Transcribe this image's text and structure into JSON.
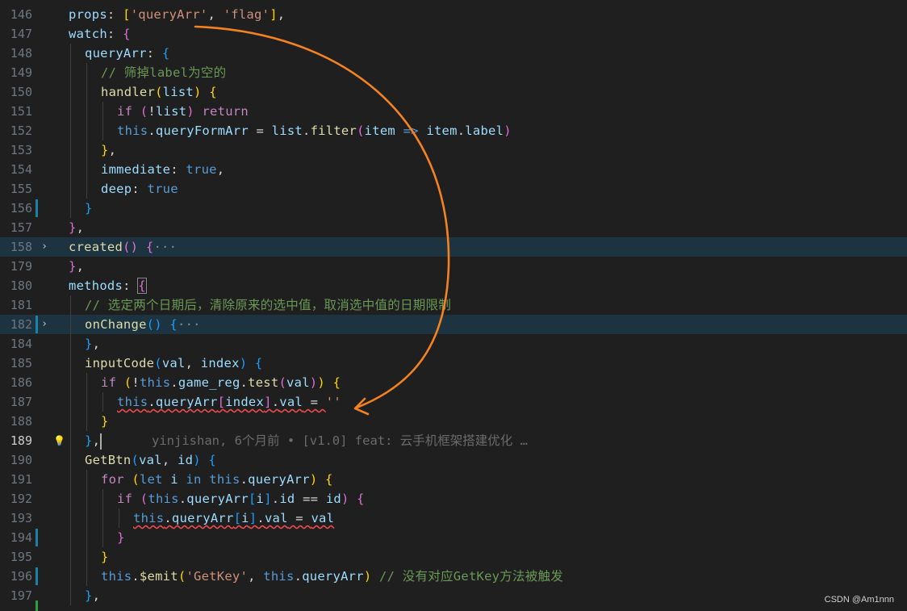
{
  "editor": {
    "lines": [
      {
        "num": "146",
        "segs": [
          [
            "v",
            "props"
          ],
          [
            "p",
            ": "
          ],
          [
            "y",
            "["
          ],
          [
            "s",
            "'queryArr'"
          ],
          [
            "p",
            ", "
          ],
          [
            "s",
            "'flag'"
          ],
          [
            "y",
            "]"
          ],
          [
            "p",
            ","
          ]
        ]
      },
      {
        "num": "147",
        "segs": [
          [
            "v",
            "watch"
          ],
          [
            "p",
            ": "
          ],
          [
            "m",
            "{"
          ]
        ]
      },
      {
        "num": "148",
        "segs": [
          [
            "v",
            "queryArr"
          ],
          [
            "p",
            ": "
          ],
          [
            "l",
            "{"
          ]
        ]
      },
      {
        "num": "149",
        "segs": [
          [
            "c",
            "// 筛掉label为空的"
          ]
        ]
      },
      {
        "num": "150",
        "segs": [
          [
            "f",
            "handler"
          ],
          [
            "y",
            "("
          ],
          [
            "v",
            "list"
          ],
          [
            "y",
            ")"
          ],
          [
            "p",
            " "
          ],
          [
            "y",
            "{"
          ]
        ]
      },
      {
        "num": "151",
        "segs": [
          [
            "k",
            "if"
          ],
          [
            "p",
            " "
          ],
          [
            "m",
            "("
          ],
          [
            "p",
            "!"
          ],
          [
            "v",
            "list"
          ],
          [
            "m",
            ")"
          ],
          [
            "p",
            " "
          ],
          [
            "k",
            "return"
          ]
        ]
      },
      {
        "num": "152",
        "segs": [
          [
            "b",
            "this"
          ],
          [
            "p",
            "."
          ],
          [
            "v",
            "queryFormArr"
          ],
          [
            "p",
            " = "
          ],
          [
            "v",
            "list"
          ],
          [
            "p",
            "."
          ],
          [
            "f",
            "filter"
          ],
          [
            "m",
            "("
          ],
          [
            "v",
            "item"
          ],
          [
            "p",
            " "
          ],
          [
            "b",
            "=>"
          ],
          [
            "p",
            " "
          ],
          [
            "v",
            "item"
          ],
          [
            "p",
            "."
          ],
          [
            "v",
            "label"
          ],
          [
            "m",
            ")"
          ]
        ]
      },
      {
        "num": "153",
        "segs": [
          [
            "y",
            "}"
          ],
          [
            "p",
            ","
          ]
        ]
      },
      {
        "num": "154",
        "segs": [
          [
            "v",
            "immediate"
          ],
          [
            "p",
            ": "
          ],
          [
            "b",
            "true"
          ],
          [
            "p",
            ","
          ]
        ]
      },
      {
        "num": "155",
        "segs": [
          [
            "v",
            "deep"
          ],
          [
            "p",
            ": "
          ],
          [
            "b",
            "true"
          ]
        ]
      },
      {
        "num": "156",
        "segs": [
          [
            "l",
            "}"
          ]
        ]
      },
      {
        "num": "157",
        "segs": [
          [
            "m",
            "}"
          ],
          [
            "p",
            ","
          ]
        ]
      },
      {
        "num": "158",
        "segs": [
          [
            "f",
            "created"
          ],
          [
            "m",
            "()"
          ],
          [
            "p",
            " "
          ],
          [
            "m",
            "{"
          ],
          [
            "g",
            "···"
          ]
        ]
      },
      {
        "num": "179",
        "segs": [
          [
            "m",
            "}"
          ],
          [
            "p",
            ","
          ]
        ]
      },
      {
        "num": "180",
        "segs": [
          [
            "v",
            "methods"
          ],
          [
            "p",
            ": "
          ],
          [
            "m",
            "{"
          ]
        ]
      },
      {
        "num": "181",
        "segs": [
          [
            "c",
            "// 选定两个日期后，清除原来的选中值，取消选中值的日期限制"
          ]
        ]
      },
      {
        "num": "182",
        "segs": [
          [
            "f",
            "onChange"
          ],
          [
            "l",
            "()"
          ],
          [
            "p",
            " "
          ],
          [
            "l",
            "{"
          ],
          [
            "g",
            "···"
          ]
        ]
      },
      {
        "num": "184",
        "segs": [
          [
            "l",
            "}"
          ],
          [
            "p",
            ","
          ]
        ]
      },
      {
        "num": "185",
        "segs": [
          [
            "f",
            "inputCode"
          ],
          [
            "l",
            "("
          ],
          [
            "v",
            "val"
          ],
          [
            "p",
            ", "
          ],
          [
            "v",
            "index"
          ],
          [
            "l",
            ")"
          ],
          [
            "p",
            " "
          ],
          [
            "l",
            "{"
          ]
        ]
      },
      {
        "num": "186",
        "segs": [
          [
            "k",
            "if"
          ],
          [
            "p",
            " "
          ],
          [
            "y",
            "("
          ],
          [
            "p",
            "!"
          ],
          [
            "b",
            "this"
          ],
          [
            "p",
            "."
          ],
          [
            "v",
            "game_reg"
          ],
          [
            "p",
            "."
          ],
          [
            "f",
            "test"
          ],
          [
            "m",
            "("
          ],
          [
            "v",
            "val"
          ],
          [
            "m",
            ")"
          ],
          [
            "y",
            ")"
          ],
          [
            "p",
            " "
          ],
          [
            "y",
            "{"
          ]
        ]
      },
      {
        "num": "187",
        "segs": [
          [
            "b",
            "this"
          ],
          [
            "p",
            "."
          ],
          [
            "v",
            "queryArr"
          ],
          [
            "m",
            "["
          ],
          [
            "v",
            "index"
          ],
          [
            "m",
            "]"
          ],
          [
            "p",
            "."
          ],
          [
            "v",
            "val"
          ],
          [
            "p",
            " = "
          ],
          [
            "s",
            "''"
          ]
        ]
      },
      {
        "num": "188",
        "segs": [
          [
            "y",
            "}"
          ]
        ]
      },
      {
        "num": "189",
        "segs": [
          [
            "l",
            "}"
          ],
          [
            "p",
            ","
          ]
        ]
      },
      {
        "num": "190",
        "segs": [
          [
            "f",
            "GetBtn"
          ],
          [
            "l",
            "("
          ],
          [
            "v",
            "val"
          ],
          [
            "p",
            ", "
          ],
          [
            "v",
            "id"
          ],
          [
            "l",
            ")"
          ],
          [
            "p",
            " "
          ],
          [
            "l",
            "{"
          ]
        ]
      },
      {
        "num": "191",
        "segs": [
          [
            "k",
            "for"
          ],
          [
            "p",
            " "
          ],
          [
            "y",
            "("
          ],
          [
            "b",
            "let"
          ],
          [
            "p",
            " "
          ],
          [
            "v",
            "i"
          ],
          [
            "p",
            " "
          ],
          [
            "b",
            "in"
          ],
          [
            "p",
            " "
          ],
          [
            "b",
            "this"
          ],
          [
            "p",
            "."
          ],
          [
            "v",
            "queryArr"
          ],
          [
            "y",
            ")"
          ],
          [
            "p",
            " "
          ],
          [
            "y",
            "{"
          ]
        ]
      },
      {
        "num": "192",
        "segs": [
          [
            "k",
            "if"
          ],
          [
            "p",
            " "
          ],
          [
            "m",
            "("
          ],
          [
            "b",
            "this"
          ],
          [
            "p",
            "."
          ],
          [
            "v",
            "queryArr"
          ],
          [
            "l",
            "["
          ],
          [
            "v",
            "i"
          ],
          [
            "l",
            "]"
          ],
          [
            "p",
            "."
          ],
          [
            "v",
            "id"
          ],
          [
            "p",
            " == "
          ],
          [
            "v",
            "id"
          ],
          [
            "m",
            ")"
          ],
          [
            "p",
            " "
          ],
          [
            "m",
            "{"
          ]
        ]
      },
      {
        "num": "193",
        "segs": [
          [
            "b",
            "this"
          ],
          [
            "p",
            "."
          ],
          [
            "v",
            "queryArr"
          ],
          [
            "l",
            "["
          ],
          [
            "v",
            "i"
          ],
          [
            "l",
            "]"
          ],
          [
            "p",
            "."
          ],
          [
            "v",
            "val"
          ],
          [
            "p",
            " = "
          ],
          [
            "v",
            "val"
          ]
        ]
      },
      {
        "num": "194",
        "segs": [
          [
            "m",
            "}"
          ]
        ]
      },
      {
        "num": "195",
        "segs": [
          [
            "y",
            "}"
          ]
        ]
      },
      {
        "num": "196",
        "segs": [
          [
            "b",
            "this"
          ],
          [
            "p",
            "."
          ],
          [
            "f",
            "$emit"
          ],
          [
            "y",
            "("
          ],
          [
            "s",
            "'GetKey'"
          ],
          [
            "p",
            ", "
          ],
          [
            "b",
            "this"
          ],
          [
            "p",
            "."
          ],
          [
            "v",
            "queryArr"
          ],
          [
            "y",
            ")"
          ],
          [
            "p",
            " "
          ],
          [
            "c",
            "// 没有对应GetKey方法被触发"
          ]
        ]
      },
      {
        "num": "197",
        "segs": [
          [
            "l",
            "}"
          ],
          [
            "p",
            ","
          ]
        ]
      }
    ],
    "blame": "yinjishan, 6个月前 • [v1.0] feat: 云手机框架搭建优化 …",
    "bulb_icon": "💡"
  },
  "watermark": "CSDN @Am1nnn",
  "colors": {
    "background": "#1f1f1f",
    "annotation_arrow": "#f58220",
    "squiggle": "#f14c4c"
  }
}
